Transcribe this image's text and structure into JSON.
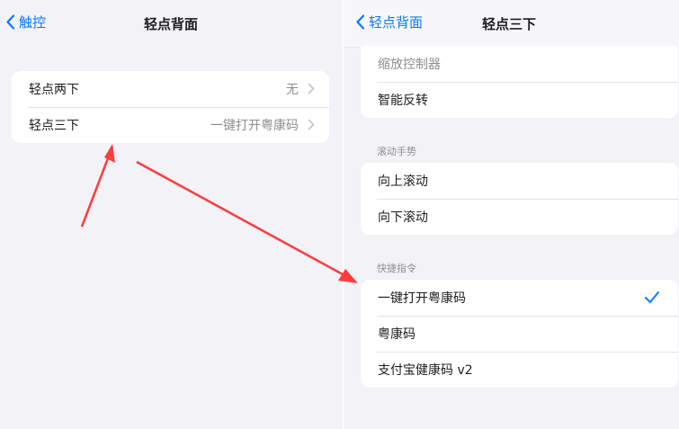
{
  "left": {
    "back_label": "触控",
    "title": "轻点背面",
    "rows": [
      {
        "label": "轻点两下",
        "value": "无"
      },
      {
        "label": "轻点三下",
        "value": "一键打开粤康码"
      }
    ]
  },
  "right": {
    "back_label": "轻点背面",
    "title": "轻点三下",
    "top_rows": [
      {
        "label": "缩放控制器"
      },
      {
        "label": "智能反转"
      }
    ],
    "scroll_header": "滚动手势",
    "scroll_rows": [
      {
        "label": "向上滚动"
      },
      {
        "label": "向下滚动"
      }
    ],
    "shortcuts_header": "快捷指令",
    "shortcut_rows": [
      {
        "label": "一键打开粤康码",
        "selected": true
      },
      {
        "label": "粤康码"
      },
      {
        "label": "支付宝健康码 v2"
      }
    ]
  },
  "colors": {
    "accent": "#0a7aff",
    "background": "#f2f2f7",
    "annotation_arrow": "#ff3b3b"
  },
  "icons": [
    "chevron-left-icon",
    "chevron-right-icon",
    "checkmark-icon",
    "annotation-arrow"
  ]
}
